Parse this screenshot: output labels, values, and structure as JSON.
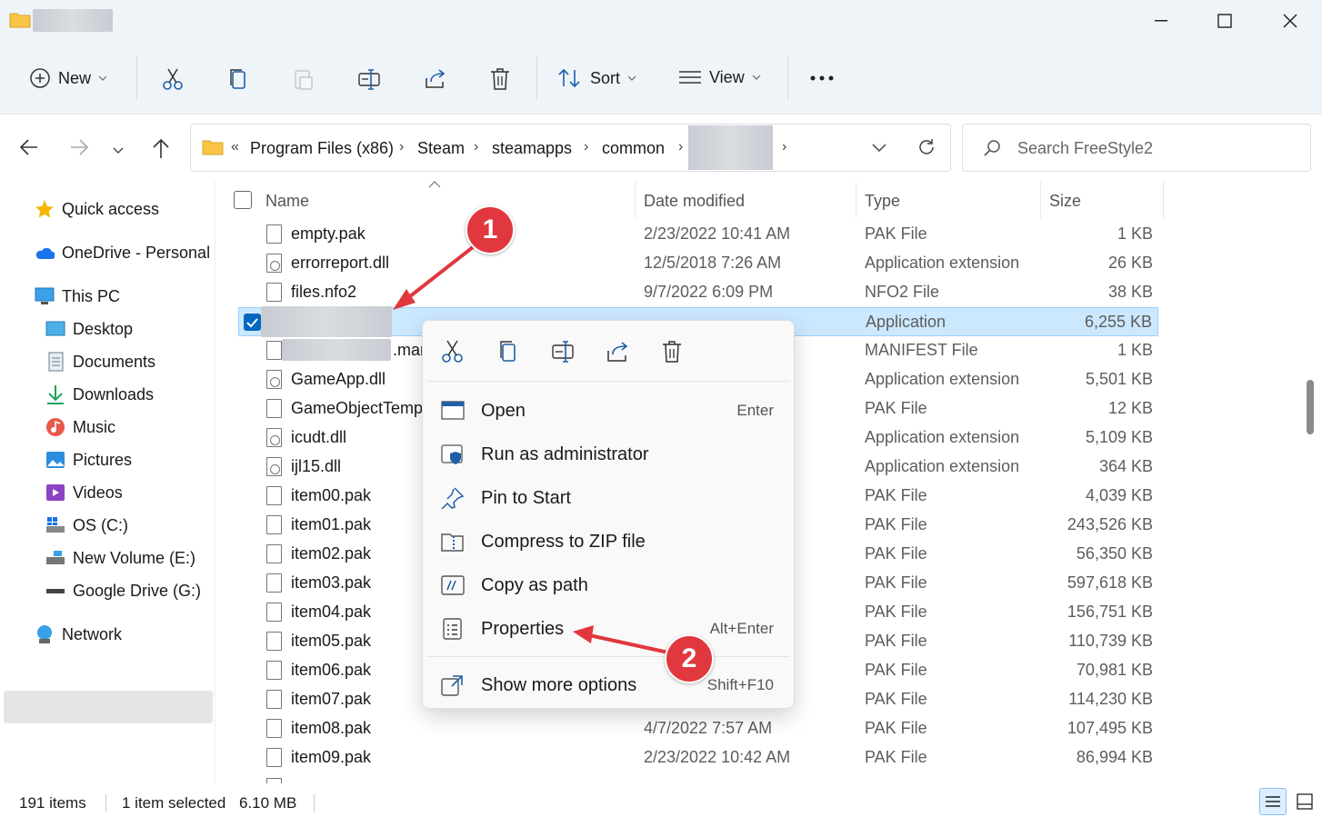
{
  "toolbar": {
    "new_label": "New",
    "sort_label": "Sort",
    "view_label": "View"
  },
  "address": {
    "crumb_prefix": "«",
    "crumbs": [
      "Program Files (x86)",
      "Steam",
      "steamapps",
      "common"
    ]
  },
  "search": {
    "placeholder": "Search FreeStyle2"
  },
  "nav": {
    "quick_access": "Quick access",
    "onedrive": "OneDrive - Personal",
    "this_pc": "This PC",
    "desktop": "Desktop",
    "documents": "Documents",
    "downloads": "Downloads",
    "music": "Music",
    "pictures": "Pictures",
    "videos": "Videos",
    "os_c": "OS (C:)",
    "new_volume": "New Volume (E:)",
    "google_drive": "Google Drive (G:)",
    "network": "Network"
  },
  "columns": {
    "name": "Name",
    "date": "Date modified",
    "type": "Type",
    "size": "Size"
  },
  "files": [
    {
      "name": "empty.pak",
      "date": "2/23/2022 10:41 AM",
      "type": "PAK File",
      "size": "1 KB",
      "kind": "pak"
    },
    {
      "name": "errorreport.dll",
      "date": "12/5/2018 7:26 AM",
      "type": "Application extension",
      "size": "26 KB",
      "kind": "dll"
    },
    {
      "name": "files.nfo2",
      "date": "9/7/2022 6:09 PM",
      "type": "NFO2 File",
      "size": "38 KB",
      "kind": "pak"
    },
    {
      "name": "",
      "date": "",
      "type": "Application",
      "size": "6,255 KB",
      "kind": "exe"
    },
    {
      "name": ".man",
      "date": "",
      "type": "MANIFEST File",
      "size": "1 KB",
      "kind": "pak"
    },
    {
      "name": "GameApp.dll",
      "date": "",
      "type": "Application extension",
      "size": "5,501 KB",
      "kind": "dll"
    },
    {
      "name": "GameObjectTemp",
      "date": "",
      "type": "PAK File",
      "size": "12 KB",
      "kind": "pak"
    },
    {
      "name": "icudt.dll",
      "date": "",
      "type": "Application extension",
      "size": "5,109 KB",
      "kind": "dll"
    },
    {
      "name": "ijl15.dll",
      "date": "",
      "type": "Application extension",
      "size": "364 KB",
      "kind": "dll"
    },
    {
      "name": "item00.pak",
      "date": "",
      "type": "PAK File",
      "size": "4,039 KB",
      "kind": "pak"
    },
    {
      "name": "item01.pak",
      "date": "",
      "type": "PAK File",
      "size": "243,526 KB",
      "kind": "pak"
    },
    {
      "name": "item02.pak",
      "date": "",
      "type": "PAK File",
      "size": "56,350 KB",
      "kind": "pak"
    },
    {
      "name": "item03.pak",
      "date": "",
      "type": "PAK File",
      "size": "597,618 KB",
      "kind": "pak"
    },
    {
      "name": "item04.pak",
      "date": "",
      "type": "PAK File",
      "size": "156,751 KB",
      "kind": "pak"
    },
    {
      "name": "item05.pak",
      "date": "",
      "type": "PAK File",
      "size": "110,739 KB",
      "kind": "pak"
    },
    {
      "name": "item06.pak",
      "date": "",
      "type": "PAK File",
      "size": "70,981 KB",
      "kind": "pak"
    },
    {
      "name": "item07.pak",
      "date": "",
      "type": "PAK File",
      "size": "114,230 KB",
      "kind": "pak"
    },
    {
      "name": "item08.pak",
      "date": "4/7/2022 7:57 AM",
      "type": "PAK File",
      "size": "107,495 KB",
      "kind": "pak"
    },
    {
      "name": "item09.pak",
      "date": "2/23/2022 10:42 AM",
      "type": "PAK File",
      "size": "86,994 KB",
      "kind": "pak"
    }
  ],
  "context_menu": {
    "items": [
      {
        "label": "Open",
        "key": "Enter",
        "icon": "open-icon"
      },
      {
        "label": "Run as administrator",
        "key": "",
        "icon": "shield-icon"
      },
      {
        "label": "Pin to Start",
        "key": "",
        "icon": "pin-icon"
      },
      {
        "label": "Compress to ZIP file",
        "key": "",
        "icon": "zip-icon"
      },
      {
        "label": "Copy as path",
        "key": "",
        "icon": "copy-path-icon"
      },
      {
        "label": "Properties",
        "key": "Alt+Enter",
        "icon": "properties-icon"
      },
      {
        "label": "Show more options",
        "key": "Shift+F10",
        "icon": "more-options-icon"
      }
    ]
  },
  "annotations": {
    "badge1": "1",
    "badge2": "2"
  },
  "status": {
    "item_count": "191 items",
    "selected": "1 item selected",
    "size": "6.10 MB"
  },
  "colors": {
    "accent": "#0067c0",
    "selection": "#cce8ff",
    "badge": "#e0383e",
    "folder": "#f8c546"
  }
}
